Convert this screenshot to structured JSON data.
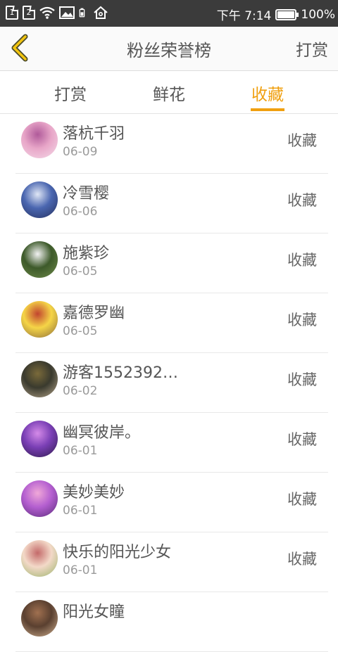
{
  "status_bar": {
    "sim1": "1",
    "sim2": "2",
    "time": "下午 7:14",
    "battery": "100%"
  },
  "header": {
    "title": "粉丝荣誉榜",
    "right_action": "打赏",
    "back_icon": "chevron-left-icon"
  },
  "tabs": [
    {
      "label": "打赏",
      "active": false
    },
    {
      "label": "鲜花",
      "active": false
    },
    {
      "label": "收藏",
      "active": true
    }
  ],
  "accent_color": "#f0a010",
  "fans": [
    {
      "name": "落杭千羽",
      "date": "06-09",
      "action": "收藏",
      "avatar_colors": [
        "#e8a6c8",
        "#b05a9a",
        "#f4dbe8"
      ]
    },
    {
      "name": "冷雪樱",
      "date": "06-06",
      "action": "收藏",
      "avatar_colors": [
        "#4a66b0",
        "#dfe6f5",
        "#25305e"
      ]
    },
    {
      "name": "施紫珍",
      "date": "06-05",
      "action": "收藏",
      "avatar_colors": [
        "#3d5a2a",
        "#f2f2f2",
        "#6f8a4a"
      ]
    },
    {
      "name": "嘉德罗幽",
      "date": "06-05",
      "action": "收藏",
      "avatar_colors": [
        "#f5d547",
        "#c2452f",
        "#8a6a3a"
      ]
    },
    {
      "name": "游客1552392…",
      "date": "06-02",
      "action": "收藏",
      "avatar_colors": [
        "#3a3a2e",
        "#7a6a3a",
        "#b5a58a"
      ]
    },
    {
      "name": "幽冥彼岸。",
      "date": "06-01",
      "action": "收藏",
      "avatar_colors": [
        "#7a3fb5",
        "#d48ae8",
        "#2e1a4a"
      ]
    },
    {
      "name": "美妙美妙",
      "date": "06-01",
      "action": "收藏",
      "avatar_colors": [
        "#b45fd0",
        "#f0a8d8",
        "#5a2a7a"
      ]
    },
    {
      "name": "快乐的阳光少女",
      "date": "06-01",
      "action": "收藏",
      "avatar_colors": [
        "#f3d9c8",
        "#c46a6a",
        "#9ab36a"
      ]
    },
    {
      "name": "阳光女瞳",
      "date": "",
      "action": "",
      "avatar_colors": [
        "#5a4030",
        "#a07050",
        "#d0b090"
      ]
    }
  ]
}
